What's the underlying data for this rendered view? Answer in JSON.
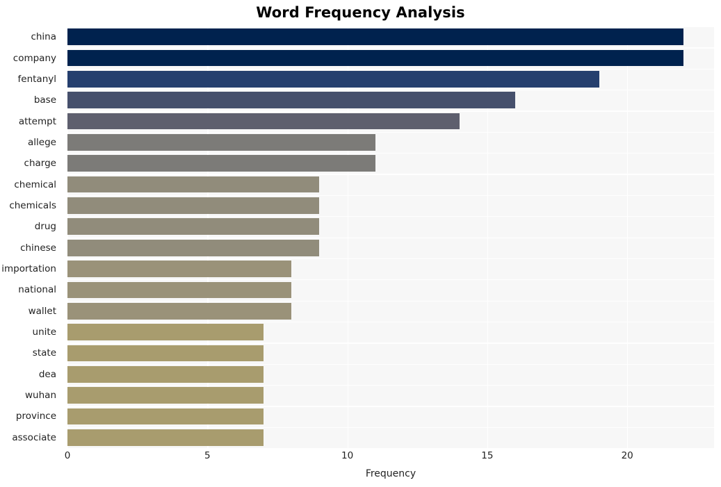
{
  "chart_data": {
    "type": "bar",
    "orientation": "horizontal",
    "title": "Word Frequency Analysis",
    "xlabel": "Frequency",
    "ylabel": "",
    "categories": [
      "china",
      "company",
      "fentanyl",
      "base",
      "attempt",
      "allege",
      "charge",
      "chemical",
      "chemicals",
      "drug",
      "chinese",
      "importation",
      "national",
      "wallet",
      "unite",
      "state",
      "dea",
      "wuhan",
      "province",
      "associate"
    ],
    "values": [
      22,
      22,
      19,
      16,
      14,
      11,
      11,
      9,
      9,
      9,
      9,
      8,
      8,
      8,
      7,
      7,
      7,
      7,
      7,
      7
    ],
    "bar_colors": [
      "#00224e",
      "#00224e",
      "#253f6e",
      "#46506c",
      "#5e5f6e",
      "#7c7b78",
      "#7c7b78",
      "#918c7b",
      "#918c7b",
      "#918c7b",
      "#918c7b",
      "#9a9279",
      "#9a9279",
      "#9a9279",
      "#a89c6e",
      "#a89c6e",
      "#a89c6e",
      "#a89c6e",
      "#a89c6e",
      "#a89c6e"
    ],
    "xlim": [
      0,
      23.1
    ],
    "ylim_count": 20,
    "xticks": [
      0,
      5,
      10,
      15,
      20
    ],
    "xtick_labels": [
      "0",
      "5",
      "10",
      "15",
      "20"
    ],
    "grid": true,
    "grid_color": "#ffffff",
    "plot_background": "#f7f7f7",
    "figure_background": "#ffffff",
    "legend": null,
    "style": "whitegrid"
  }
}
